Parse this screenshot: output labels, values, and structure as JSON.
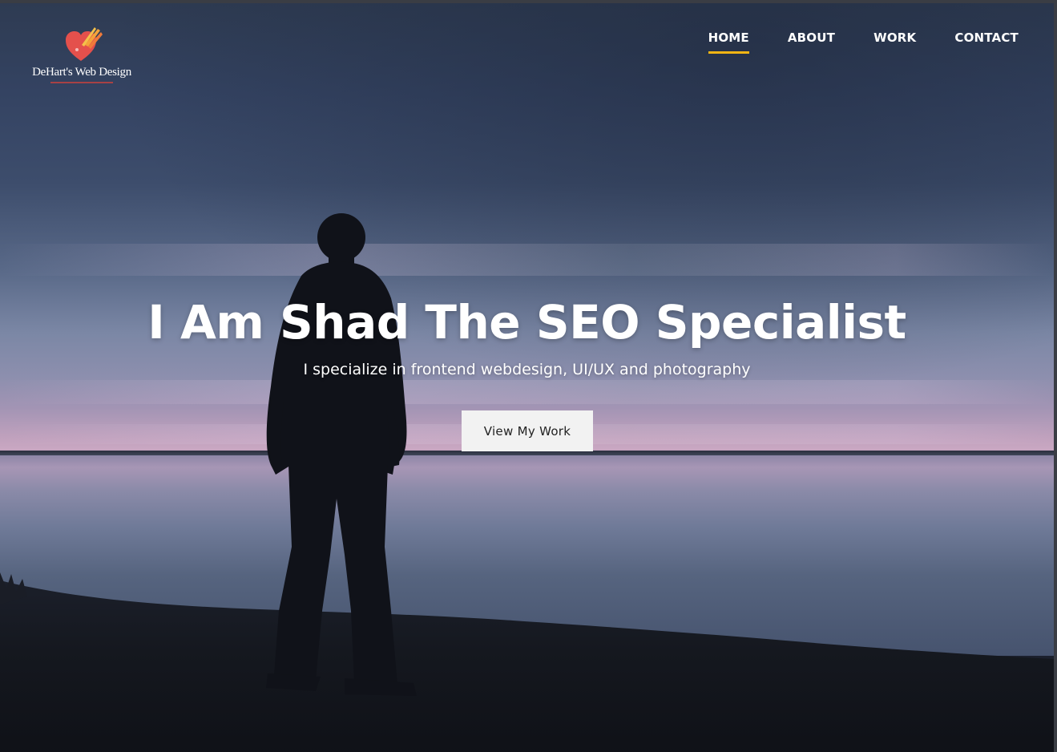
{
  "brand": {
    "name": "DeHart's Web Design",
    "logo_icon": "heart-rocket-icon",
    "accent_color": "#e4504c"
  },
  "nav": {
    "items": [
      {
        "label": "HOME",
        "active": true
      },
      {
        "label": "ABOUT",
        "active": false
      },
      {
        "label": "WORK",
        "active": false
      },
      {
        "label": "CONTACT",
        "active": false
      }
    ],
    "active_color": "#f2b514"
  },
  "hero": {
    "headline": "I Am Shad The SEO Specialist",
    "subheadline": "I specialize in frontend webdesign, UI/UX and photography",
    "cta_label": "View My Work"
  }
}
